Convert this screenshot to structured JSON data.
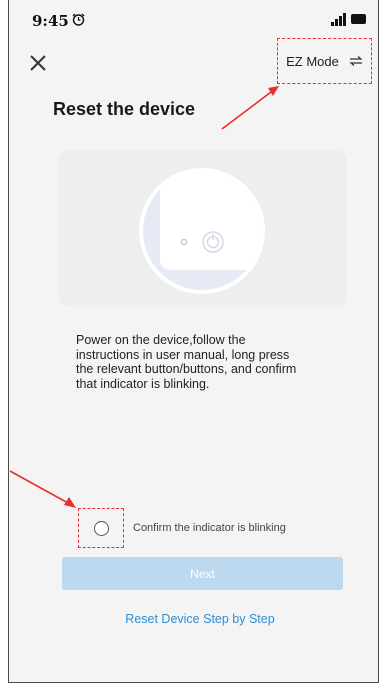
{
  "status_bar": {
    "time": "9:45",
    "alarm_icon": "alarm-clock-icon",
    "signal_icon": "signal-bars-icon",
    "battery_icon": "battery-icon"
  },
  "header": {
    "close_icon": "close-icon",
    "mode_label": "EZ Mode",
    "mode_switch_icon": "swap-arrows-icon",
    "title": "Reset the device"
  },
  "illustration": {
    "device_icon": "power-button-icon"
  },
  "instructions": "Power on the device,follow the instructions in user manual, long press the relevant button/buttons, and confirm that indicator is blinking.",
  "confirm": {
    "label": "Confirm the indicator is blinking",
    "checked": false
  },
  "next_button": {
    "label": "Next",
    "enabled": false
  },
  "step_link": "Reset Device Step by Step",
  "colors": {
    "annotation": "#e63030",
    "accent": "#2c8fd4",
    "button_disabled": "#bcd9f0",
    "background": "#f4f4f4"
  }
}
